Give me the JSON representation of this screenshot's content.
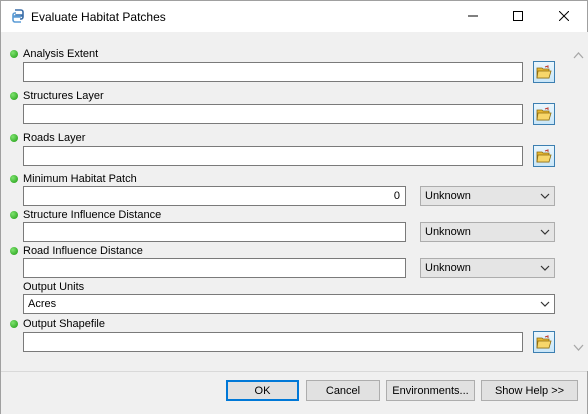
{
  "window": {
    "title": "Evaluate Habitat Patches"
  },
  "fields": {
    "analysis_extent": {
      "label": "Analysis Extent",
      "value": ""
    },
    "structures_layer": {
      "label": "Structures Layer",
      "value": ""
    },
    "roads_layer": {
      "label": "Roads Layer",
      "value": ""
    },
    "minimum_habitat_patch": {
      "label": "Minimum Habitat Patch",
      "value": "0",
      "unit": "Unknown"
    },
    "structure_influence_distance": {
      "label": "Structure Influence Distance",
      "value": "",
      "unit": "Unknown"
    },
    "road_influence_distance": {
      "label": "Road Influence Distance",
      "value": "",
      "unit": "Unknown"
    },
    "output_units": {
      "label": "Output Units",
      "value": "Acres"
    },
    "output_shapefile": {
      "label": "Output Shapefile",
      "value": ""
    }
  },
  "buttons": {
    "ok": "OK",
    "cancel": "Cancel",
    "environments": "Environments...",
    "show_help": "Show Help >>"
  },
  "colors": {
    "required_dot": "#1d9a12",
    "default_button_border": "#0078d7",
    "folder": "#e8b830"
  },
  "icons": {
    "app": "python-script-icon",
    "browse": "open-folder-icon"
  }
}
